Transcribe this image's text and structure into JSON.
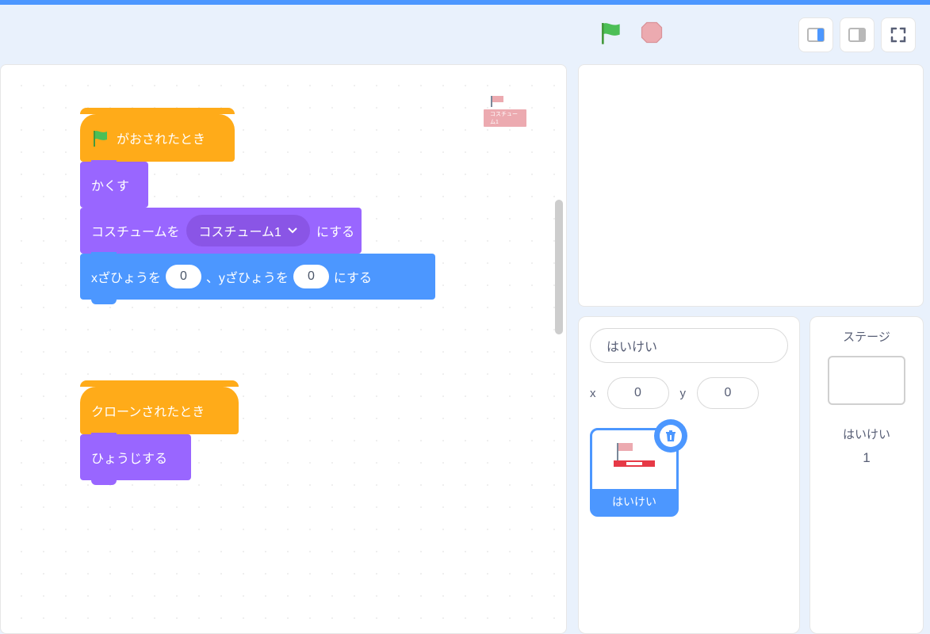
{
  "header": {
    "go_icon": "green-flag-icon",
    "stop_icon": "stop-icon"
  },
  "blocks": {
    "script1": {
      "hat_flag_label": "がおされたとき",
      "hide_label": "かくす",
      "costume_label_pre": "コスチュームを",
      "costume_dropdown": "コスチューム1",
      "costume_label_post": "にする",
      "goto_x_label": "xざひょうを",
      "goto_x_val": "0",
      "goto_mid": "、yざひょうを",
      "goto_y_val": "0",
      "goto_post": "にする"
    },
    "script2": {
      "hat_clone_label": "クローンされたとき",
      "show_label": "ひょうじする"
    },
    "thumb_label": "コスチューム1"
  },
  "sprite": {
    "name": "はいけい",
    "x_label": "x",
    "x_val": "0",
    "y_label": "y",
    "y_val": "0",
    "tile_label": "はいけい"
  },
  "stage": {
    "title": "ステージ",
    "bg_label": "はいけい",
    "bg_count": "1"
  }
}
